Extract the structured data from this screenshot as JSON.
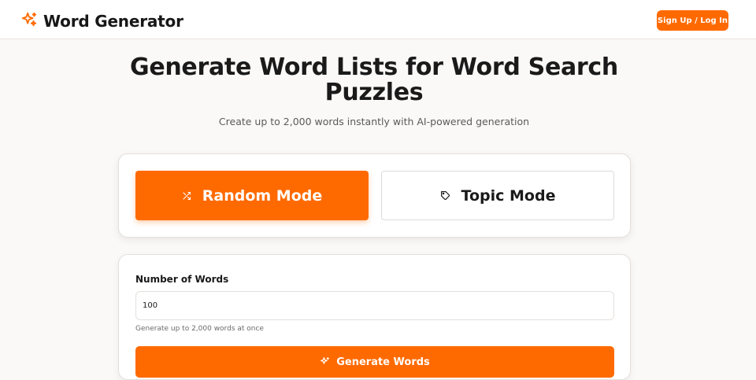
{
  "header": {
    "brand": "Word Generator",
    "brand_icon": "sparkles-icon",
    "auth_label": "Sign Up / Log In"
  },
  "hero": {
    "title": "Generate Word Lists for Word Search Puzzles",
    "subtitle": "Create up to 2,000 words instantly with AI-powered generation"
  },
  "modes": [
    {
      "label": "Random Mode",
      "icon": "shuffle-icon",
      "selected": true
    },
    {
      "label": "Topic Mode",
      "icon": "tag-icon",
      "selected": false
    }
  ],
  "form": {
    "count_label": "Number of Words",
    "count_value": "100",
    "hint": "Generate up to 2,000 words at once",
    "submit_label": "Generate Words",
    "submit_icon": "sparkles-icon"
  },
  "colors": {
    "accent": "#ff6a00",
    "background": "#fbf9f8",
    "text": "#1a1a1a"
  }
}
